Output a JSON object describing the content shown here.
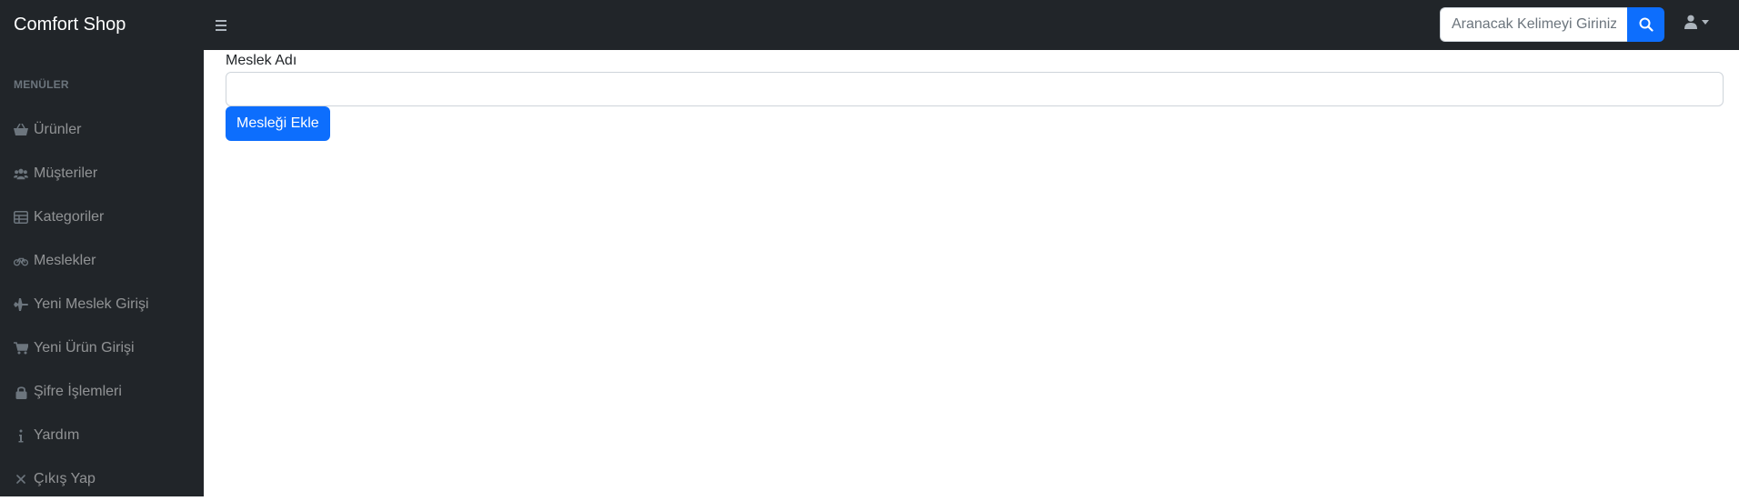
{
  "header": {
    "brand": "Comfort Shop",
    "toggle_icon": "bars-icon",
    "search": {
      "placeholder": "Aranacak Kelimeyi Giriniz.",
      "button_icon": "search-icon"
    },
    "user_icon": "user-icon"
  },
  "sidebar": {
    "heading": "MENÜLER",
    "items": [
      {
        "label": "Ürünler",
        "icon": "basket-icon"
      },
      {
        "label": "Müşteriler",
        "icon": "users-icon"
      },
      {
        "label": "Kategoriler",
        "icon": "table-icon"
      },
      {
        "label": "Meslekler",
        "icon": "bicycle-icon"
      },
      {
        "label": "Yeni Meslek Girişi",
        "icon": "plane-icon"
      },
      {
        "label": "Yeni Ürün Girişi",
        "icon": "cart-icon"
      },
      {
        "label": "Şifre İşlemleri",
        "icon": "lock-icon"
      },
      {
        "label": "Yardım",
        "icon": "info-icon"
      },
      {
        "label": "Çıkış Yap",
        "icon": "close-icon"
      }
    ]
  },
  "form": {
    "label": "Meslek Adı",
    "value": "",
    "submit_label": "Mesleği Ekle"
  },
  "colors": {
    "nav_bg": "#212529",
    "primary": "#0d6efd",
    "sidebar_text": "rgba(255,255,255,0.5)"
  }
}
